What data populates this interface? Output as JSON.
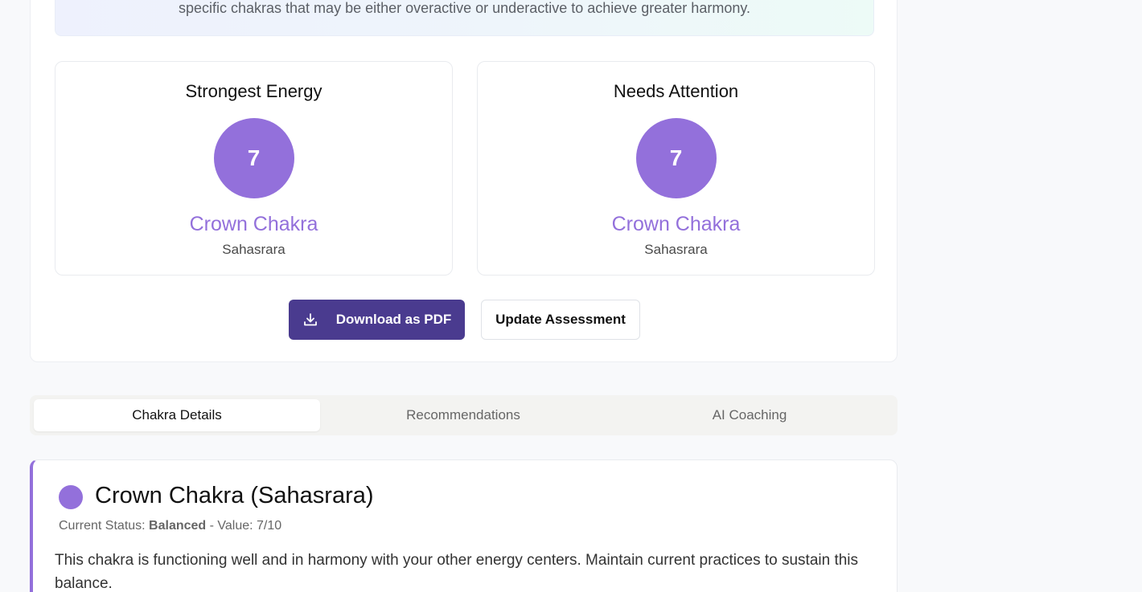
{
  "intro": {
    "text": "specific chakras that may be either overactive or underactive to achieve greater harmony."
  },
  "strongest": {
    "title": "Strongest Energy",
    "number": "7",
    "name": "Crown Chakra",
    "sanskrit": "Sahasrara"
  },
  "attention": {
    "title": "Needs Attention",
    "number": "7",
    "name": "Crown Chakra",
    "sanskrit": "Sahasrara"
  },
  "actions": {
    "download_label": "Download as PDF",
    "download_icon": "download-icon",
    "update_label": "Update Assessment"
  },
  "tabs": [
    {
      "label": "Chakra Details",
      "active": true
    },
    {
      "label": "Recommendations",
      "active": false
    },
    {
      "label": "AI Coaching",
      "active": false
    }
  ],
  "detail": {
    "title": "Crown Chakra (Sahasrara)",
    "status_prefix": "Current Status: ",
    "status_value": "Balanced",
    "value_text": " - Value: 7/10",
    "description": "This chakra is functioning well and in harmony with your other energy centers. Maintain current practices to sustain this balance."
  },
  "colors": {
    "crown": "#9370db",
    "primary_button": "#4a3b8f"
  }
}
